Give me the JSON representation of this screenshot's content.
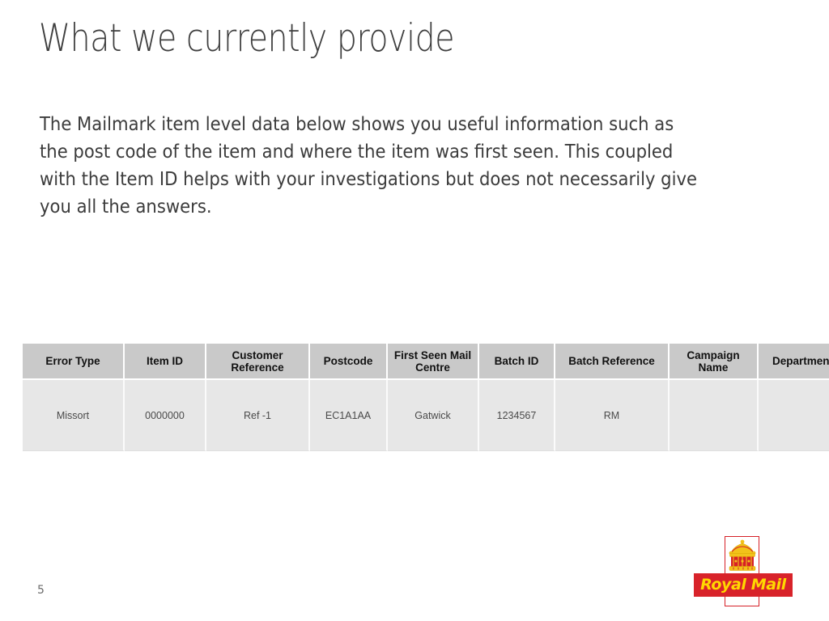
{
  "slide": {
    "title": "What we currently provide",
    "body": "The Mailmark item level data below shows you useful information such as the post code of the item and where the item was first seen.  This coupled with the Item ID helps with your investigations but does not necessarily give you all the answers.",
    "page_number": "5"
  },
  "logo": {
    "name": "royal-mail-logo",
    "wordmark": "Royal Mail",
    "banner_color": "#d8232a",
    "text_color": "#ffd800",
    "crown_icon": "crown-icon",
    "crown_gold": "#f2c21a",
    "crown_red": "#d62027"
  },
  "table": {
    "header_bg": "#c9c9c9",
    "cell_bg": "#e7e7e7",
    "columns": [
      "Error Type",
      "Item ID",
      "Customer Reference",
      "Postcode",
      "First Seen Mail Centre",
      "Batch ID",
      "Batch Reference",
      "Campaign Name",
      "Department"
    ],
    "rows": [
      {
        "error_type": "Missort",
        "item_id": "0000000",
        "customer_reference": "Ref -1",
        "postcode": "EC1A1AA",
        "first_seen_mail_centre": "Gatwick",
        "batch_id": "1234567",
        "batch_reference": "RM",
        "campaign_name": "",
        "department": ""
      }
    ]
  }
}
